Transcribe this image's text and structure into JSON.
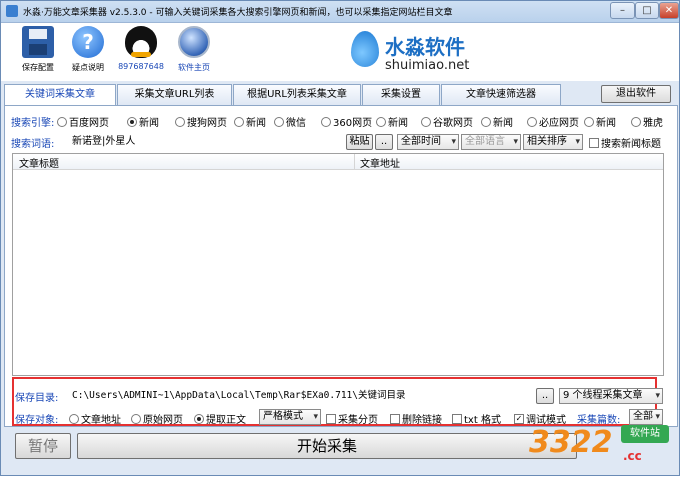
{
  "window": {
    "title": "水淼·万能文章采集器 v2.5.3.0 - 可输入关键词采集各大搜索引擎网页和新闻，也可以采集指定网站栏目文章",
    "controls": {
      "minimize": "–",
      "maximize": "□",
      "close": "✕"
    }
  },
  "toolbar": {
    "items": [
      {
        "label": "保存配置",
        "icon": "save-icon"
      },
      {
        "label": "疑点说明",
        "icon": "help-icon"
      },
      {
        "label": "897687648",
        "icon": "qq-icon"
      },
      {
        "label": "软件主页",
        "icon": "globe-icon"
      }
    ]
  },
  "brand": {
    "cn": "水淼软件",
    "en": "shuimiao.net"
  },
  "tabs": [
    "关键词采集文章",
    "采集文章URL列表",
    "根据URL列表采集文章",
    "采集设置",
    "文章快速筛选器"
  ],
  "exit_label": "退出软件",
  "search_engine": {
    "label": "搜索引擎:",
    "options": [
      {
        "label": "百度网页",
        "checked": false
      },
      {
        "label": "新闻",
        "checked": true
      },
      {
        "label": "搜狗网页",
        "checked": false
      },
      {
        "label": "新闻",
        "checked": false
      },
      {
        "label": "微信",
        "checked": false
      },
      {
        "label": "360网页",
        "checked": false
      },
      {
        "label": "新闻",
        "checked": false
      },
      {
        "label": "谷歌网页",
        "checked": false
      },
      {
        "label": "新闻",
        "checked": false
      },
      {
        "label": "必应网页",
        "checked": false
      },
      {
        "label": "新闻",
        "checked": false
      },
      {
        "label": "雅虎",
        "checked": false
      }
    ]
  },
  "keywords": {
    "label": "搜索词语:",
    "value": "新诺登|外星人",
    "paste_label": "粘贴",
    "dots_label": "..",
    "time_select": "全部时间",
    "lang_select": "全部语言",
    "sort_select": "相关排序",
    "news_title_check": "搜索新闻标题"
  },
  "table": {
    "columns": [
      "文章标题",
      "文章地址"
    ],
    "rows": []
  },
  "save_dir": {
    "label": "保存目录:",
    "value": "C:\\Users\\ADMINI~1\\AppData\\Local\\Temp\\Rar$EXa0.711\\关键词目录",
    "browse_label": "..",
    "threads_select": "9 个线程采集文章"
  },
  "save_target": {
    "label": "保存对象:",
    "options": [
      {
        "label": "文章地址",
        "checked": false
      },
      {
        "label": "原始网页",
        "checked": false
      },
      {
        "label": "提取正文",
        "checked": true
      }
    ],
    "mode_select": "严格模式",
    "checks": [
      {
        "label": "采集分页",
        "checked": false
      },
      {
        "label": "删除链接",
        "checked": false
      },
      {
        "label": "txt 格式",
        "checked": false
      },
      {
        "label": "调试模式",
        "checked": true
      }
    ],
    "count_label": "采集篇数:",
    "count_value": "全部"
  },
  "actions": {
    "pause": "暂停",
    "start": "开始采集"
  },
  "watermark": {
    "big": "3322",
    "tag": "软件站",
    "sub": ".cc"
  },
  "colors": {
    "accent_blue": "#1947b6",
    "highlight_red": "#e53131",
    "brand_blue": "#1d6fc4"
  }
}
